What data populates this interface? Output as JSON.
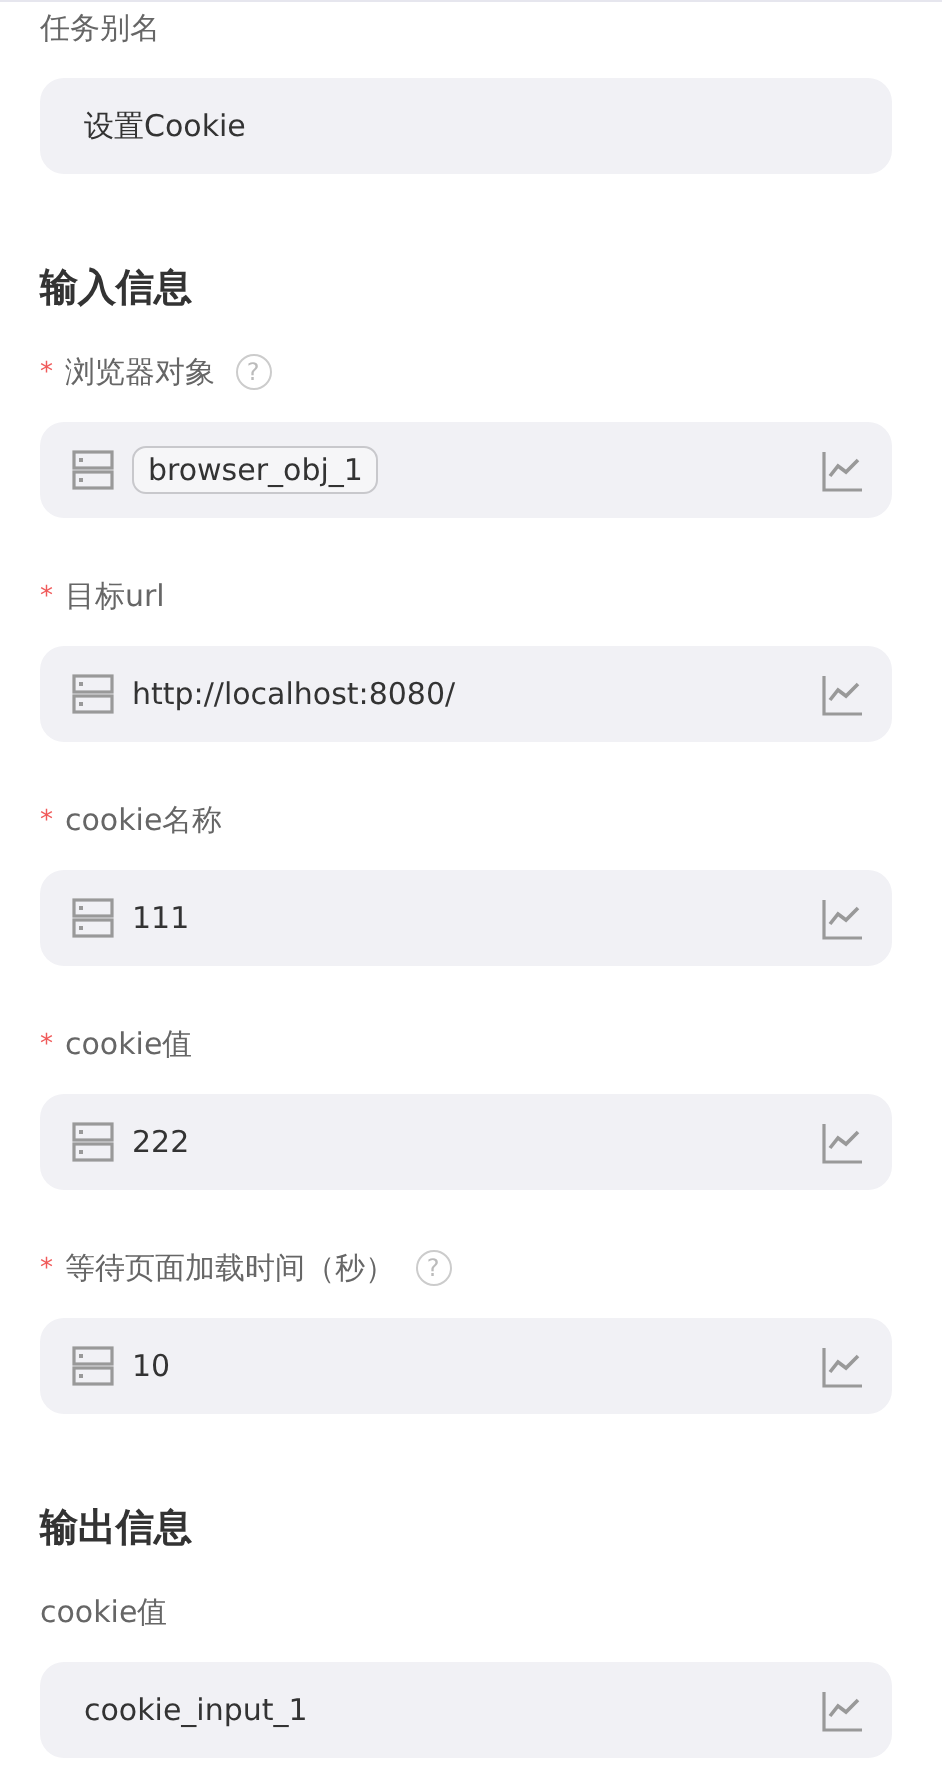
{
  "task_alias": {
    "label": "任务别名",
    "value": "设置Cookie"
  },
  "sections": [
    {
      "title": "输入信息",
      "fields": [
        {
          "label": "浏览器对象",
          "required": true,
          "required_mark": "*",
          "help": true,
          "help_icon": "?",
          "kind": "variable",
          "value": "browser_obj_1",
          "chip": true
        },
        {
          "label": "目标url",
          "required": true,
          "required_mark": "*",
          "help": false,
          "kind": "variable",
          "value": "http://localhost:8080/",
          "chip": false
        },
        {
          "label": "cookie名称",
          "required": true,
          "required_mark": "*",
          "help": false,
          "kind": "variable",
          "value": "111",
          "chip": false
        },
        {
          "label": "cookie值",
          "required": true,
          "required_mark": "*",
          "help": false,
          "kind": "variable",
          "value": "222",
          "chip": false
        },
        {
          "label": "等待页面加载时间（秒）",
          "required": true,
          "required_mark": "*",
          "help": true,
          "help_icon": "?",
          "kind": "variable",
          "value": "10",
          "chip": false
        }
      ]
    },
    {
      "title": "输出信息",
      "fields": [
        {
          "label": "cookie值",
          "required": false,
          "help": false,
          "kind": "text",
          "value": "cookie_input_1",
          "chip": false
        }
      ]
    }
  ]
}
